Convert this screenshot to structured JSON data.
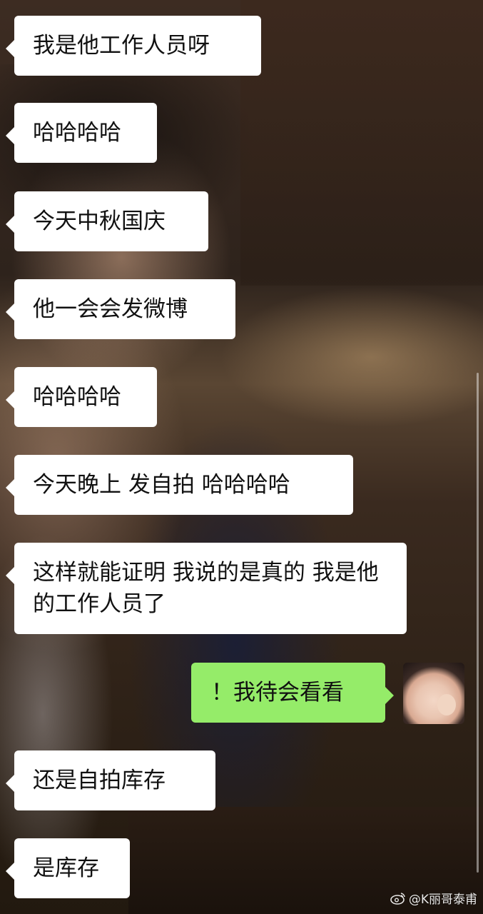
{
  "messages": [
    {
      "text": "我是他工作人员呀",
      "sender": "other"
    },
    {
      "text": "哈哈哈哈",
      "sender": "other"
    },
    {
      "text": "今天中秋国庆",
      "sender": "other"
    },
    {
      "text": "他一会会发微博",
      "sender": "other"
    },
    {
      "text": "哈哈哈哈",
      "sender": "other"
    },
    {
      "text": "今天晚上 发自拍 哈哈哈哈",
      "sender": "other"
    },
    {
      "text": "这样就能证明 我说的是真的 我是他的工作人员了",
      "sender": "other"
    },
    {
      "text": "！我待会看看",
      "sender": "me"
    },
    {
      "text": "还是自拍库存",
      "sender": "other"
    },
    {
      "text": "是库存",
      "sender": "other"
    }
  ],
  "watermark": {
    "text": "@K丽哥泰甫",
    "icon": "weibo-icon"
  },
  "colors": {
    "incoming_bubble": "#ffffff",
    "outgoing_bubble": "#95ec69"
  }
}
